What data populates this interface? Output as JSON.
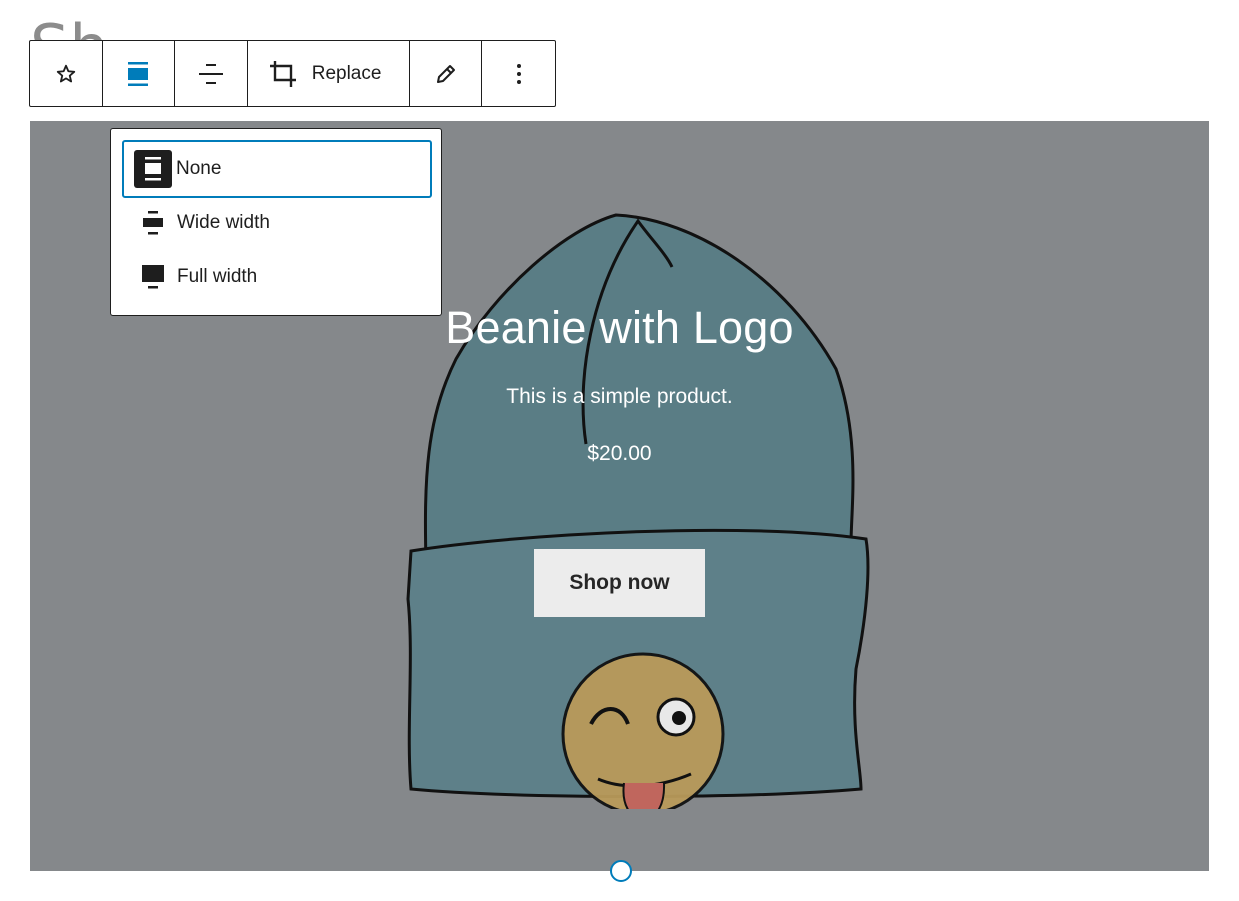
{
  "page": {
    "background_heading": "Sh"
  },
  "toolbar": {
    "replace_label": "Replace"
  },
  "align_menu": {
    "options": [
      {
        "label": "None",
        "selected": true
      },
      {
        "label": "Wide width",
        "selected": false
      },
      {
        "label": "Full width",
        "selected": false
      }
    ]
  },
  "cover": {
    "title": "Beanie with Logo",
    "description": "This is a simple product.",
    "price": "$20.00",
    "button_label": "Shop now",
    "overlay_color": "#85888b"
  },
  "colors": {
    "accent": "#007cba",
    "toolbar_border": "#1e1e1e"
  }
}
